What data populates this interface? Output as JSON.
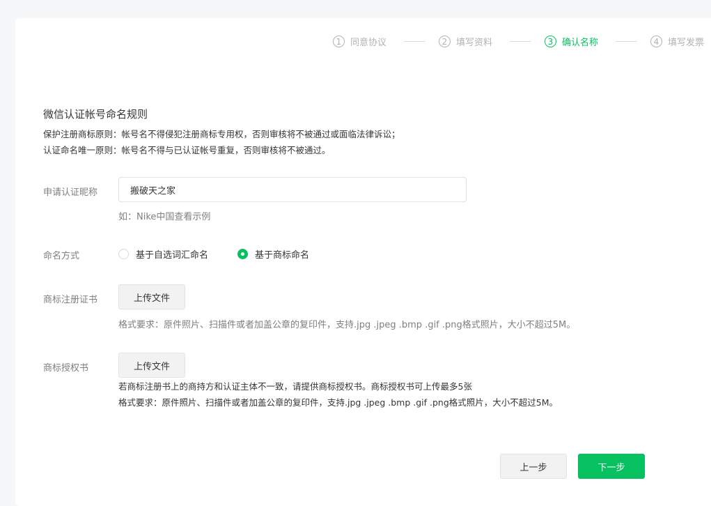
{
  "stepper": {
    "steps": [
      {
        "num": "1",
        "label": "同意协议",
        "active": false
      },
      {
        "num": "2",
        "label": "填写资料",
        "active": false
      },
      {
        "num": "3",
        "label": "确认名称",
        "active": true
      },
      {
        "num": "4",
        "label": "填写发票",
        "active": false
      }
    ]
  },
  "rules": {
    "title": "微信认证帐号命名规则",
    "line1": "保护注册商标原则：帐号名不得侵犯注册商标专用权，否则审核将不被通过或面临法律诉讼；",
    "line2": "认证命名唯一原则：帐号名不得与已认证帐号重复，否则审核将不被通过。"
  },
  "form": {
    "nickname_label": "申请认证昵称",
    "nickname_value": "搬破天之家",
    "nickname_hint": "如：Nike中国查看示例",
    "naming_label": "命名方式",
    "naming_options": [
      {
        "label": "基于自选词汇命名",
        "checked": false
      },
      {
        "label": "基于商标命名",
        "checked": true
      }
    ],
    "trademark_cert_label": "商标注册证书",
    "upload_label": "上传文件",
    "format_note": "格式要求：原件照片、扫描件或者加盖公章的复印件，支持.jpg .jpeg .bmp .gif .png格式照片，大小不超过5M。",
    "trademark_auth_label": "商标授权书",
    "auth_note": "若商标注册书上的商持方和认证主体不一致，请提供商标授权书。商标授权书可上传最多5张"
  },
  "actions": {
    "prev_label": "上一步",
    "next_label": "下一步"
  },
  "colors": {
    "accent": "#07c160",
    "muted": "#b2b2b2",
    "label": "#7f7f7f"
  }
}
